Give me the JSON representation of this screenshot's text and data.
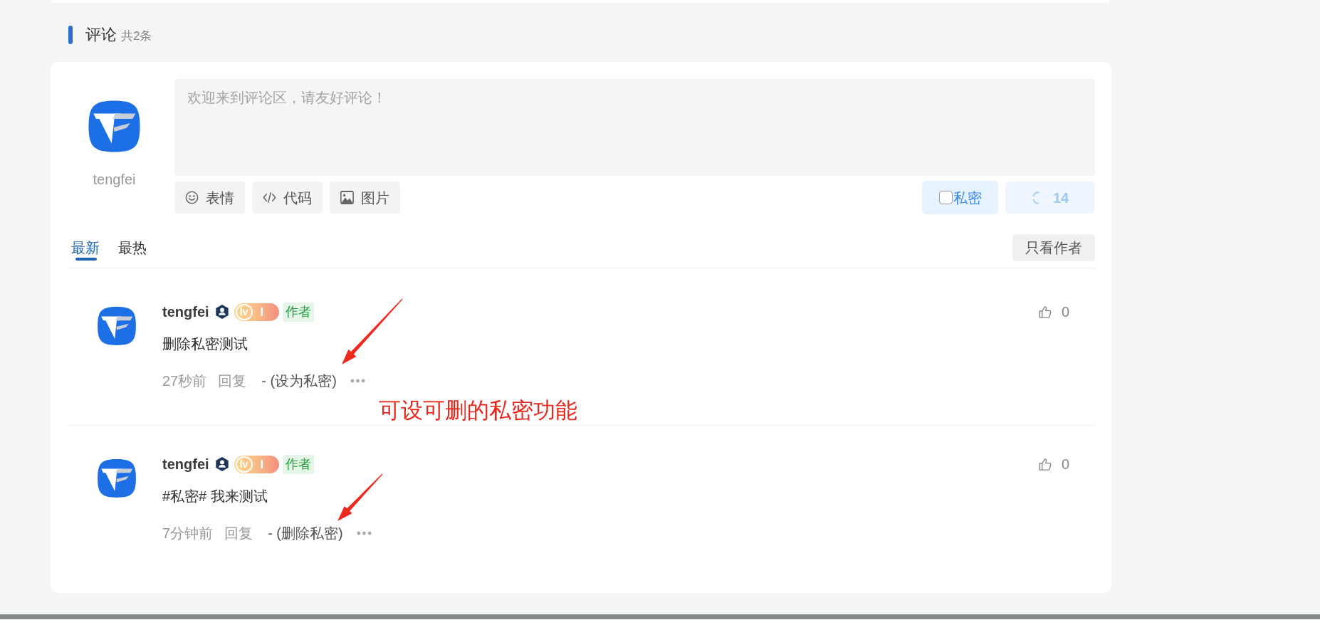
{
  "section": {
    "title": "评论",
    "count": "共2条"
  },
  "editor": {
    "user": "tengfei",
    "placeholder": "欢迎来到评论区，请友好评论！",
    "tools": [
      {
        "kind": "emoji",
        "label": "表情"
      },
      {
        "kind": "code",
        "label": "代码"
      },
      {
        "kind": "image",
        "label": "图片"
      }
    ],
    "private": {
      "label": "私密",
      "checked": false
    },
    "submit": {
      "label": "14",
      "disabled": true
    }
  },
  "tabs": [
    {
      "label": "最新",
      "selected": true
    },
    {
      "label": "最热",
      "selected": false
    }
  ],
  "author_filter": "只看作者",
  "comments": [
    {
      "author": "tengfei",
      "level": {
        "prefix": "lv",
        "number": "I"
      },
      "tag": "作者",
      "content": "删除私密测试",
      "time": "27秒前",
      "reply": "回复",
      "private_action": "- (设为私密)",
      "likes": "0",
      "arrow": true
    },
    {
      "author": "tengfei",
      "level": {
        "prefix": "lv",
        "number": "I"
      },
      "tag": "作者",
      "content": "#私密# 我来测试",
      "time": "7分钟前",
      "reply": "回复",
      "private_action": "- (删除私密)",
      "likes": "0",
      "arrow": true
    }
  ],
  "annotation": "可设可删的私密功能"
}
